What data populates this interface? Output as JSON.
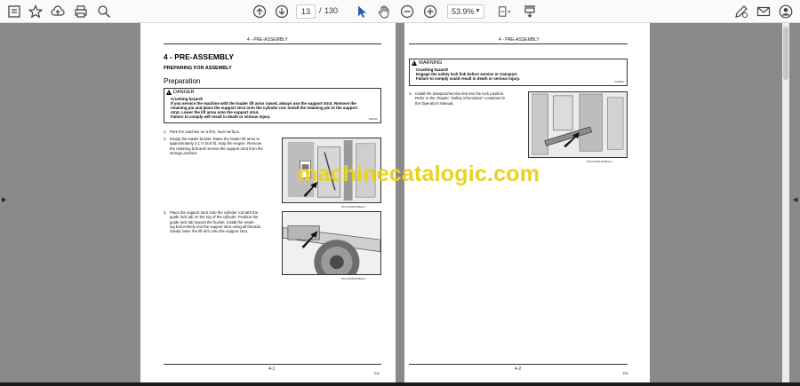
{
  "toolbar": {
    "current_page": "13",
    "page_separator": "/",
    "total_pages": "130",
    "zoom_level": "53.9%"
  },
  "watermark": "machinecatalogic.com",
  "page1": {
    "running_head": "4 - PRE-ASSEMBLY",
    "chapter_title": "4 - PRE-ASSEMBLY",
    "section_title": "PREPARING FOR ASSEMBLY",
    "subsection_title": "Preparation",
    "danger": {
      "label": "DANGER",
      "lines": [
        "Crushing hazard!",
        "If you service the machine with the loader lift arms raised, always use the support strut. Remove the",
        "retaining pin and place the support strut onto the cylinder rod. Install the retaining pin to the support",
        "strut. Lower the lift arms onto the support strut.",
        "Failure to comply will result in death or serious injury."
      ],
      "code": "D0051A"
    },
    "steps": [
      {
        "num": "1.",
        "lines": [
          "Park the machine on a firm, level surface."
        ]
      },
      {
        "num": "2.",
        "lines": [
          "Empty the loader bucket. Raise the loader lift arms to",
          "approximately 2.1 m (6.9 ft). Stop the engine. Remove",
          "the retaining bolt and remove the support strut from the",
          "storage position."
        ]
      },
      {
        "num": "3.",
        "lines": [
          "Place the support strut onto the cylinder rod with the",
          "guide lock tab on the top of the cylinder. Position the",
          "guide lock tab toward the bucket. Install the retain-",
          "ing bolt entirely into the support strut using all threads.",
          "Slowly lower the lift arm onto the support strut."
        ]
      }
    ],
    "fig1_code": "RCIL12MRJ005BAA    1",
    "fig2_code": "RCIL12MRJ006BAA    2",
    "page_number": "4-1",
    "language": "EN"
  },
  "page2": {
    "running_head": "4 - PRE-ASSEMBLY",
    "warning": {
      "label": "WARNING",
      "lines": [
        "Crushing hazard!",
        "Engage the safety lock link before service or transport.",
        "Failure to comply could result in death or serious injury."
      ],
      "code": "W0190A"
    },
    "steps": [
      {
        "num": "4.",
        "lines": [
          "Install the transport/service link into the lock position.",
          "Refer to the chapter \"Safety information\" contained in",
          "the Operator's Manual."
        ]
      }
    ],
    "fig3_code": "RCPH12MRJ020BAA    3",
    "page_number": "4-2",
    "language": "EN"
  }
}
